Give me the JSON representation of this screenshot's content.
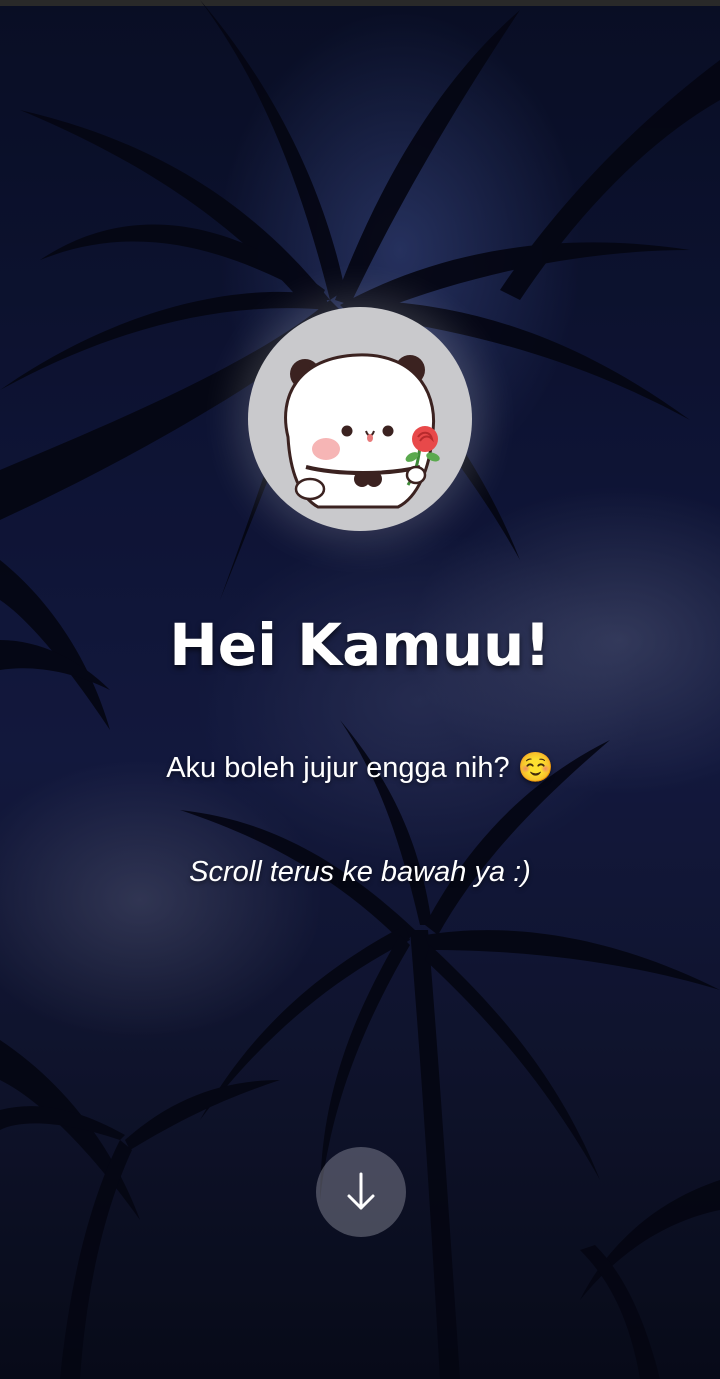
{
  "hero": {
    "title": "Hei Kamuu!",
    "subtitle": "Aku boleh jujur engga nih? ☺️",
    "hint": "Scroll terus ke bawah ya :)"
  },
  "avatar": {
    "icon": "panda-holding-rose-icon"
  },
  "scroll_button": {
    "icon": "arrow-down-icon"
  },
  "colors": {
    "text": "#ffffff",
    "avatar_bg": "#c9c9cc",
    "sky": "#141c4a"
  }
}
